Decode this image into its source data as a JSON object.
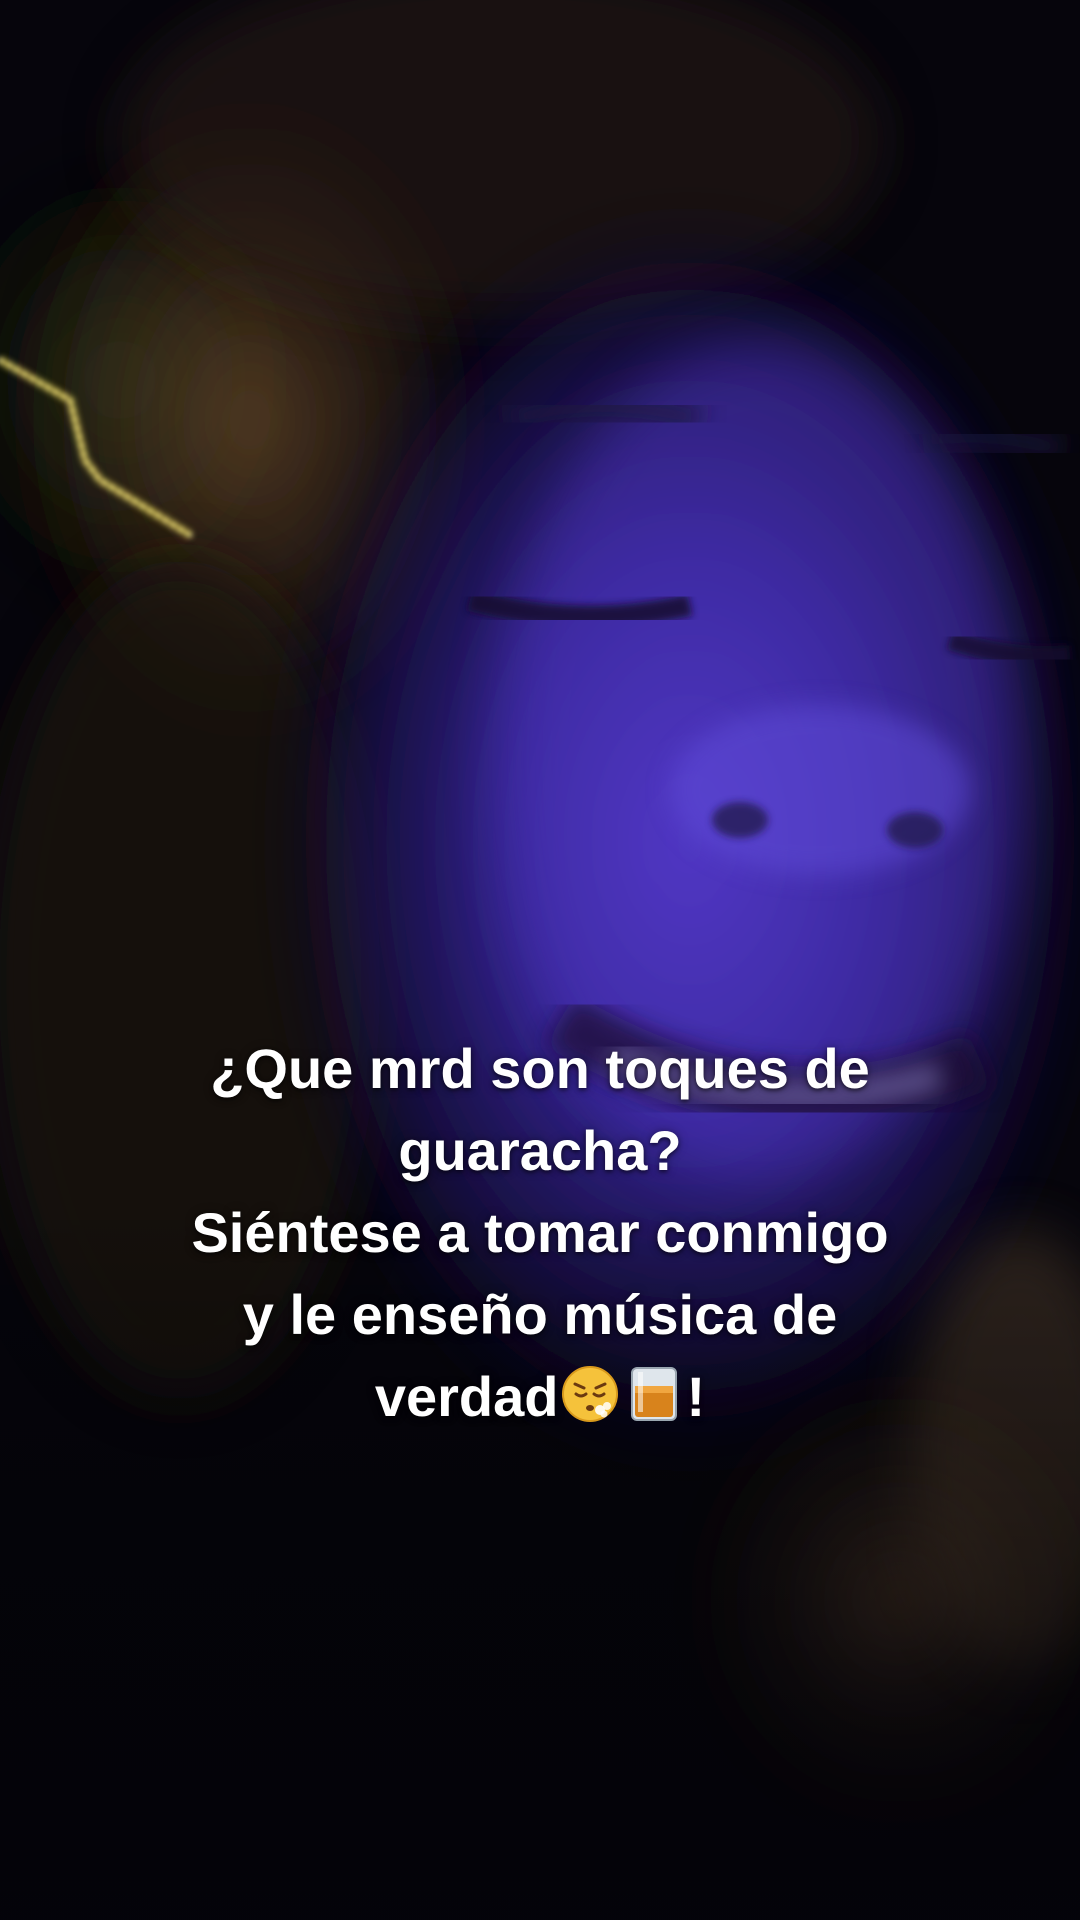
{
  "caption": {
    "lines": [
      "¿Que mrd son toques de",
      "guaracha?",
      "Siéntese a tomar conmigo",
      "y le enseño música de"
    ],
    "last_line_text": "verdad",
    "last_line_suffix": "!",
    "emojis": [
      "face-exhaling-icon",
      "tumbler-glass-icon"
    ]
  }
}
